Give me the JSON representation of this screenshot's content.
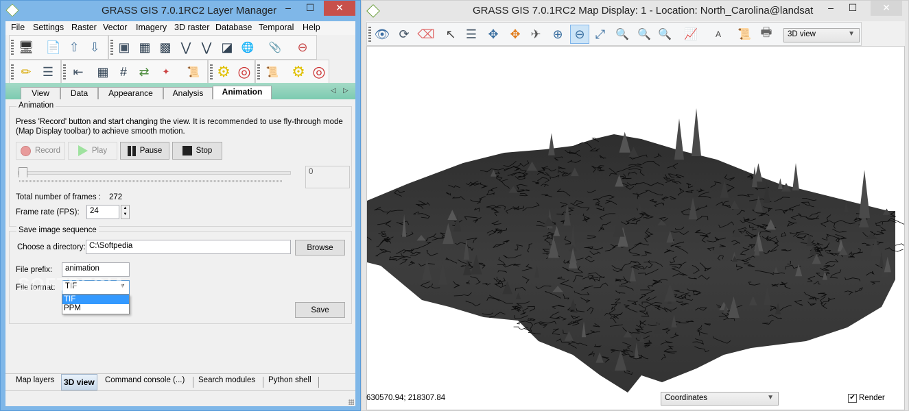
{
  "layer_manager": {
    "title": "GRASS GIS 7.0.1RC2 Layer Manager",
    "window_controls": {
      "minimize": "–",
      "maximize": "☐",
      "close": "✕"
    },
    "menu": [
      "File",
      "Settings",
      "Raster",
      "Vector",
      "Imagery",
      "3D raster",
      "Database",
      "Temporal",
      "Help"
    ],
    "toolbar_row1": [
      {
        "icon": "new-display-icon",
        "glyph": "🖥"
      },
      {
        "icon": "new-workspace-icon",
        "glyph": "📄"
      },
      {
        "icon": "load-workspace-icon",
        "glyph": "⇧"
      },
      {
        "icon": "save-workspace-icon",
        "glyph": "⇩"
      },
      {
        "icon": "add-map-layers-icon",
        "glyph": "▣"
      },
      {
        "icon": "add-raster-icon",
        "glyph": "▦"
      },
      {
        "icon": "add-raster-misc-icon",
        "glyph": "▩"
      },
      {
        "icon": "add-vector-icon",
        "glyph": "⋁"
      },
      {
        "icon": "add-vector-misc-icon",
        "glyph": "⋁"
      },
      {
        "icon": "add-group-icon",
        "glyph": "◪"
      },
      {
        "icon": "add-web-service-icon",
        "glyph": "🌐"
      },
      {
        "icon": "add-overlay-icon",
        "glyph": "📎"
      },
      {
        "icon": "remove-layer-icon",
        "glyph": "⊖"
      }
    ],
    "toolbar_row2": [
      {
        "icon": "edit-vector-icon",
        "glyph": "✏"
      },
      {
        "icon": "attribute-table-icon",
        "glyph": "☰"
      },
      {
        "icon": "import-raster-icon",
        "glyph": "⇤"
      },
      {
        "icon": "raster-calculator-icon",
        "glyph": "▦"
      },
      {
        "icon": "georectify-icon",
        "glyph": "#"
      },
      {
        "icon": "graphical-modeler-icon",
        "glyph": "⇄"
      },
      {
        "icon": "cartographic-composer-icon",
        "glyph": "✦"
      },
      {
        "icon": "run-script-icon",
        "glyph": "📜"
      },
      {
        "icon": "settings-icon",
        "glyph": "⚙"
      },
      {
        "icon": "help-icon",
        "glyph": "◎"
      },
      {
        "icon": "script-load-icon",
        "glyph": "📜"
      },
      {
        "icon": "module-settings-icon",
        "glyph": "⚙"
      },
      {
        "icon": "module-help-icon",
        "glyph": "◎"
      }
    ],
    "tabs": [
      {
        "label": "View",
        "active": false
      },
      {
        "label": "Data",
        "active": false
      },
      {
        "label": "Appearance",
        "active": false
      },
      {
        "label": "Analysis",
        "active": false
      },
      {
        "label": "Animation",
        "active": true
      }
    ],
    "tab_scroll": {
      "left": "◁",
      "right": "▷"
    },
    "animation": {
      "group_label": "Animation",
      "description": "Press 'Record' button and start changing the view. It is recommended to use fly-through mode (Map Display toolbar) to achieve smooth motion.",
      "buttons": {
        "record": {
          "label": "Record",
          "enabled": false
        },
        "play": {
          "label": "Play",
          "enabled": false
        },
        "pause": {
          "label": "Pause",
          "enabled": true
        },
        "stop": {
          "label": "Stop",
          "enabled": true
        }
      },
      "slider_value": 0,
      "frame_display": "0",
      "total_frames_label": "Total number of frames :",
      "total_frames": "272",
      "fps_label": "Frame rate (FPS):",
      "fps_value": "24"
    },
    "save_sequence": {
      "group_label": "Save image sequence",
      "directory_label": "Choose a directory:",
      "directory_value": "C:\\Softpedia",
      "browse_label": "Browse",
      "prefix_label": "File prefix:",
      "prefix_value": "animation",
      "format_label": "File format:",
      "format_value": "TIF",
      "format_options": [
        "TIF",
        "PPM"
      ],
      "save_label": "Save"
    },
    "bottom_tabs": [
      {
        "label": "Map layers",
        "active": false
      },
      {
        "label": "3D view",
        "active": true
      },
      {
        "label": "Command console (...)",
        "active": false
      },
      {
        "label": "Search modules",
        "active": false
      },
      {
        "label": "Python shell",
        "active": false
      }
    ],
    "watermark": "SOFTPEDIA"
  },
  "map_display": {
    "title": "GRASS GIS 7.0.1RC2 Map Display: 1  - Location: North_Carolina@landsat",
    "window_controls": {
      "minimize": "–",
      "maximize": "☐",
      "close": "✕"
    },
    "toolbar": [
      {
        "icon": "display-map-icon",
        "glyph": "👁"
      },
      {
        "icon": "render-map-icon",
        "glyph": "⟳"
      },
      {
        "icon": "erase-display-icon",
        "glyph": "⌫"
      },
      {
        "icon": "pointer-icon",
        "glyph": "↖"
      },
      {
        "icon": "query-icon",
        "glyph": "☰"
      },
      {
        "icon": "pan-icon",
        "glyph": "✥"
      },
      {
        "icon": "rotate-icon",
        "glyph": "✥"
      },
      {
        "icon": "fly-through-icon",
        "glyph": "✈"
      },
      {
        "icon": "zoom-in-icon",
        "glyph": "⊕"
      },
      {
        "icon": "zoom-out-icon",
        "glyph": "⊖"
      },
      {
        "icon": "zoom-extent-icon",
        "glyph": "⤢"
      },
      {
        "icon": "zoom-region-icon",
        "glyph": "🔍"
      },
      {
        "icon": "zoom-back-icon",
        "glyph": "🔍"
      },
      {
        "icon": "zoom-menu-icon",
        "glyph": "🔍"
      },
      {
        "icon": "analyze-icon",
        "glyph": "📈"
      },
      {
        "icon": "decoration-icon",
        "glyph": "A"
      },
      {
        "icon": "save-file-icon",
        "glyph": "📜"
      },
      {
        "icon": "print-icon",
        "glyph": "🖶"
      }
    ],
    "active_tool": "zoom-out-icon",
    "mode_select": "3D view",
    "status": {
      "coordinates": "630570.94; 218307.84",
      "mode": "Coordinates",
      "render_label": "Render",
      "render_checked": true
    },
    "surface_color": "#3a3a3a"
  }
}
